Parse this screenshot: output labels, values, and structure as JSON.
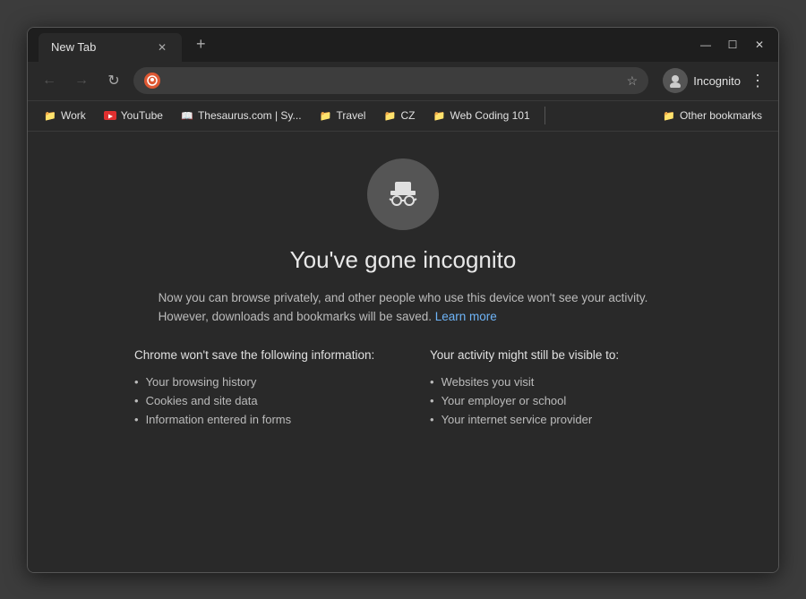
{
  "window": {
    "title": "New Tab",
    "minimize": "—",
    "maximize": "☐",
    "close": "✕"
  },
  "tab": {
    "label": "New Tab",
    "close_icon": "✕",
    "new_tab_icon": "+"
  },
  "nav": {
    "back_icon": "←",
    "forward_icon": "→",
    "refresh_icon": "↻",
    "star_icon": "☆"
  },
  "incognito_bar": {
    "label": "Incognito",
    "menu_icon": "⋮"
  },
  "bookmarks": [
    {
      "id": "work",
      "label": "Work",
      "color": "yellow",
      "icon": "📁"
    },
    {
      "id": "youtube",
      "label": "YouTube",
      "color": "red",
      "icon": "▶"
    },
    {
      "id": "thesaurus",
      "label": "Thesaurus.com | Sy...",
      "color": "orange",
      "icon": "📖"
    },
    {
      "id": "travel",
      "label": "Travel",
      "color": "yellow",
      "icon": "📁"
    },
    {
      "id": "cz",
      "label": "CZ",
      "color": "yellow",
      "icon": "📁"
    },
    {
      "id": "webcode",
      "label": "Web Coding 101",
      "color": "yellow",
      "icon": "📁"
    },
    {
      "id": "other",
      "label": "Other bookmarks",
      "color": "yellow",
      "icon": "📁"
    }
  ],
  "main": {
    "title": "You've gone incognito",
    "description_line1": "Now you can browse privately, and other people who use this device won't see your activity.",
    "description_line2": "However, downloads and bookmarks will be saved.",
    "learn_more": "Learn more",
    "chrome_wont_save_title": "Chrome won't save the following information:",
    "chrome_wont_save_list": [
      "Your browsing history",
      "Cookies and site data",
      "Information entered in forms"
    ],
    "activity_visible_title": "Your activity might still be visible to:",
    "activity_visible_list": [
      "Websites you visit",
      "Your employer or school",
      "Your internet service provider"
    ]
  }
}
